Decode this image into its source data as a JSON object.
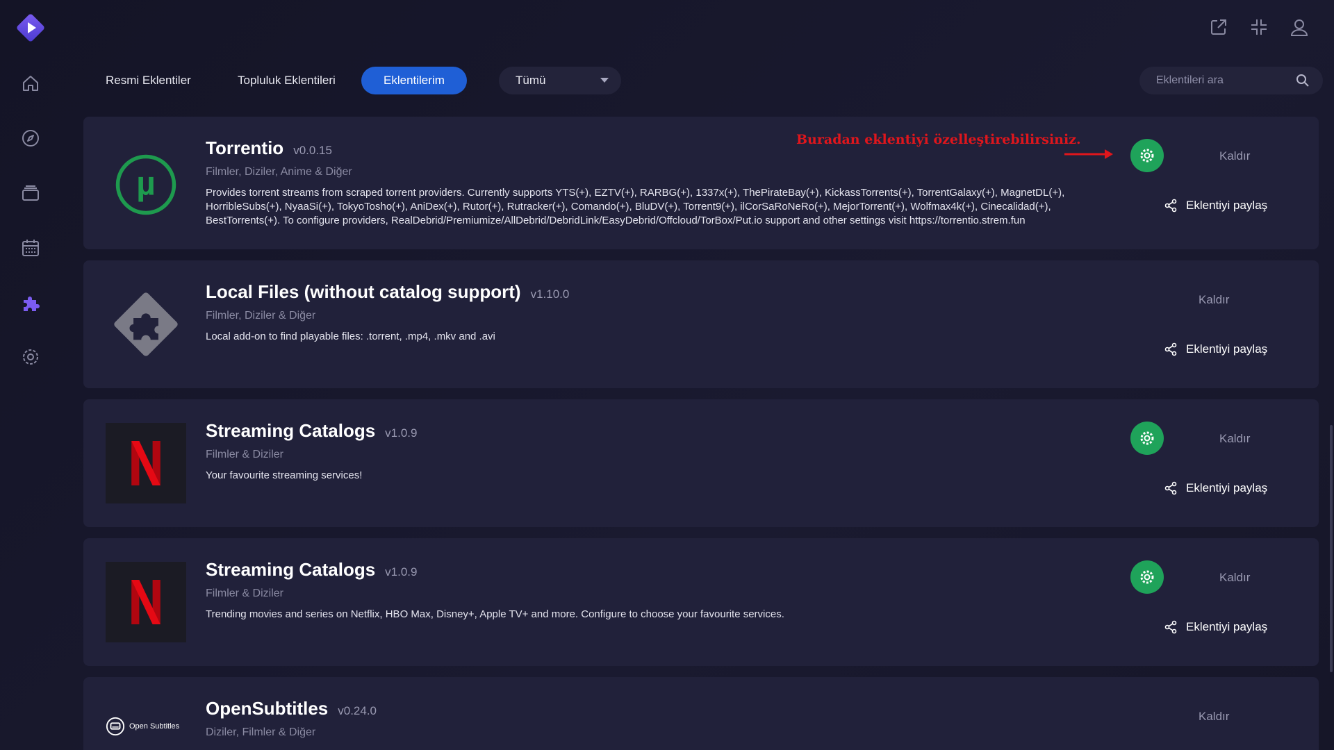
{
  "tabs": [
    {
      "label": "Resmi Eklentiler"
    },
    {
      "label": "Topluluk Eklentileri"
    },
    {
      "label": "Eklentilerim"
    }
  ],
  "filter": {
    "selected": "Tümü"
  },
  "search": {
    "placeholder": "Eklentileri ara"
  },
  "annotation": "Buradan eklentiyi özelleştirebilirsiniz.",
  "addons": [
    {
      "name": "Torrentio",
      "version": "v0.0.15",
      "types": "Filmler, Diziler, Anime & Diğer",
      "description": "Provides torrent streams from scraped torrent providers. Currently supports YTS(+), EZTV(+), RARBG(+), 1337x(+), ThePirateBay(+), KickassTorrents(+), TorrentGalaxy(+), MagnetDL(+), HorribleSubs(+), NyaaSi(+), TokyoTosho(+), AniDex(+), Rutor(+), Rutracker(+), Comando(+), BluDV(+), Torrent9(+), ilCorSaRoNeRo(+), MejorTorrent(+), Wolfmax4k(+), Cinecalidad(+), BestTorrents(+). To configure providers, RealDebrid/Premiumize/AllDebrid/DebridLink/EasyDebrid/Offcloud/TorBox/Put.io support and other settings visit https://torrentio.strem.fun",
      "remove_label": "Kaldır",
      "share_label": "Eklentiyi paylaş"
    },
    {
      "name": "Local Files (without catalog support)",
      "version": "v1.10.0",
      "types": "Filmler, Diziler & Diğer",
      "description": "Local add-on to find playable files: .torrent, .mp4, .mkv and .avi",
      "remove_label": "Kaldır",
      "share_label": "Eklentiyi paylaş"
    },
    {
      "name": "Streaming Catalogs",
      "version": "v1.0.9",
      "types": "Filmler & Diziler",
      "description": "Your favourite streaming services!",
      "remove_label": "Kaldır",
      "share_label": "Eklentiyi paylaş"
    },
    {
      "name": "Streaming Catalogs",
      "version": "v1.0.9",
      "types": "Filmler & Diziler",
      "description": "Trending movies and series on Netflix, HBO Max, Disney+, Apple TV+ and more. Configure to choose your favourite services.",
      "remove_label": "Kaldır",
      "share_label": "Eklentiyi paylaş"
    },
    {
      "name": "OpenSubtitles",
      "version": "v0.24.0",
      "types": "Diziler, Filmler & Diğer",
      "logo_text": "Open Subtitles",
      "remove_label": "Kaldır"
    }
  ],
  "colors": {
    "background": "#17172a",
    "card": "#21213a",
    "accent": "#1f5fd6",
    "configure": "#1fa35a",
    "annotation": "#e0161c",
    "sidebar_active": "#7b5cf0"
  },
  "icons": {
    "sidebar": [
      "home-icon",
      "discover-icon",
      "library-icon",
      "calendar-icon",
      "addons-icon",
      "settings-icon"
    ],
    "topbar": [
      "external-link-icon",
      "minimize-icon",
      "user-icon"
    ]
  }
}
